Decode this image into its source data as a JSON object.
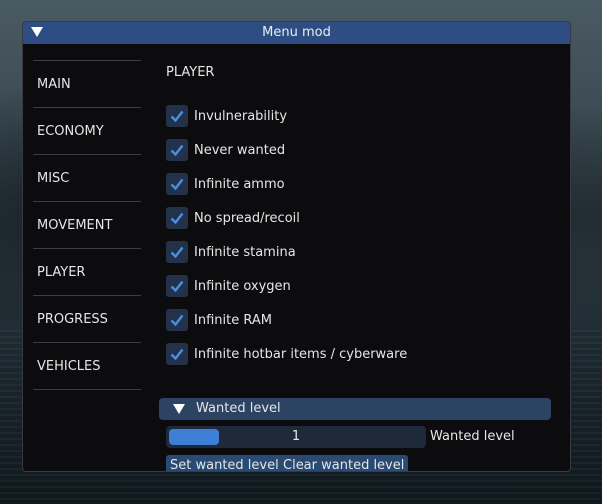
{
  "window": {
    "title": "Menu mod"
  },
  "sidebar": {
    "items": [
      {
        "label": "MAIN"
      },
      {
        "label": "ECONOMY"
      },
      {
        "label": "MISC"
      },
      {
        "label": "MOVEMENT"
      },
      {
        "label": "PLAYER"
      },
      {
        "label": "PROGRESS"
      },
      {
        "label": "VEHICLES"
      }
    ]
  },
  "player": {
    "section_title": "PLAYER",
    "options": [
      {
        "label": "Invulnerability",
        "checked": true
      },
      {
        "label": "Never wanted",
        "checked": true
      },
      {
        "label": "Infinite ammo",
        "checked": true
      },
      {
        "label": "No spread/recoil",
        "checked": true
      },
      {
        "label": "Infinite stamina",
        "checked": true
      },
      {
        "label": "Infinite oxygen",
        "checked": true
      },
      {
        "label": "Infinite RAM",
        "checked": true
      },
      {
        "label": "Infinite hotbar items / cyberware",
        "checked": true
      }
    ],
    "wanted": {
      "header": "Wanted level",
      "slider_value": "1",
      "slider_label": "Wanted level",
      "set_button": "Set wanted level",
      "clear_button": "Clear wanted level"
    }
  },
  "colors": {
    "titlebar": "#2e4e83",
    "check": "#4a90e2",
    "accent": "#3d7fd6"
  }
}
